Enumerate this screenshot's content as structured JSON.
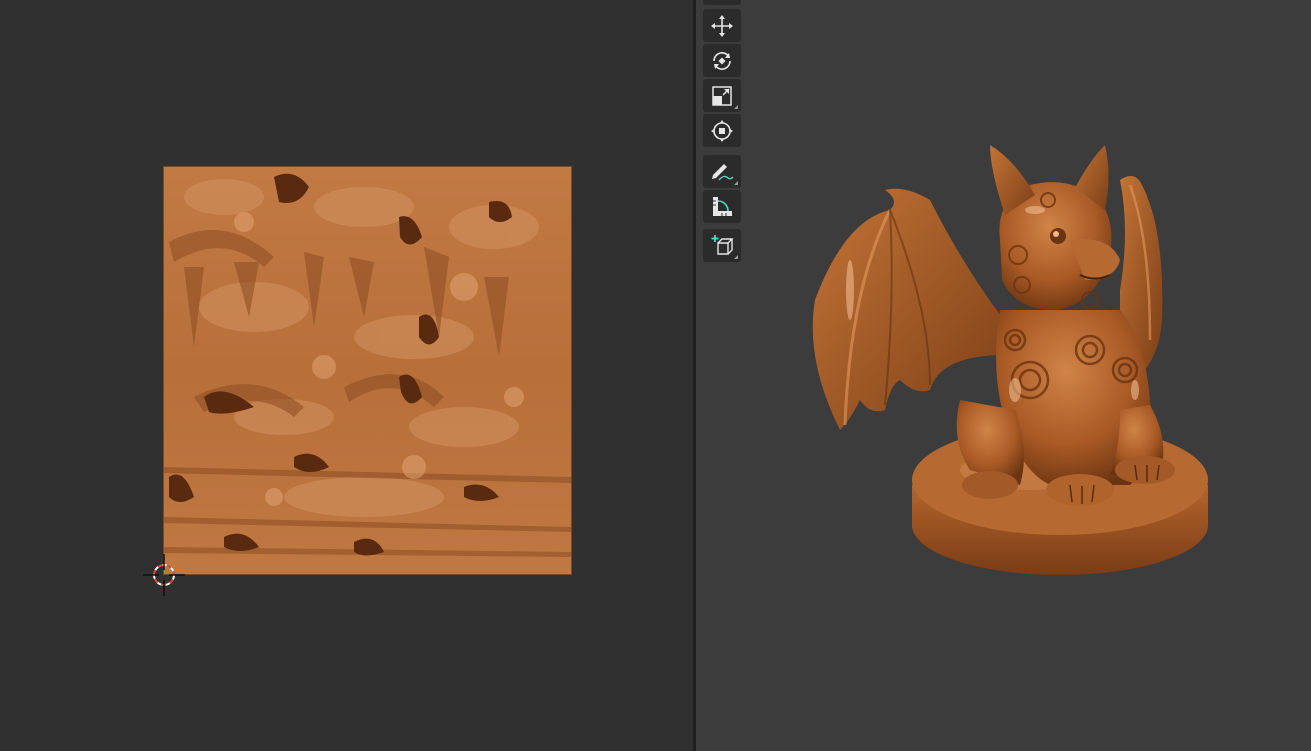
{
  "editors": {
    "left": "image-editor",
    "right": "3d-viewport"
  },
  "toolbar": {
    "tools": [
      {
        "name": "move",
        "icon": "move-icon",
        "active": false
      },
      {
        "name": "rotate",
        "icon": "rotate-icon",
        "active": false
      },
      {
        "name": "scale",
        "icon": "scale-icon",
        "active": false
      },
      {
        "name": "transform",
        "icon": "transform-icon",
        "active": false
      },
      {
        "name": "annotate",
        "icon": "annotate-icon",
        "active": false
      },
      {
        "name": "measure",
        "icon": "measure-icon",
        "active": false
      },
      {
        "name": "add-cube",
        "icon": "add-cube-icon",
        "active": false
      }
    ]
  },
  "colors": {
    "editor_bg": "#303031",
    "viewport_bg": "#3c3c3d",
    "tool_bg": "#2b2b2b",
    "material": "#b0642c",
    "accent": "#5fd3c1"
  }
}
